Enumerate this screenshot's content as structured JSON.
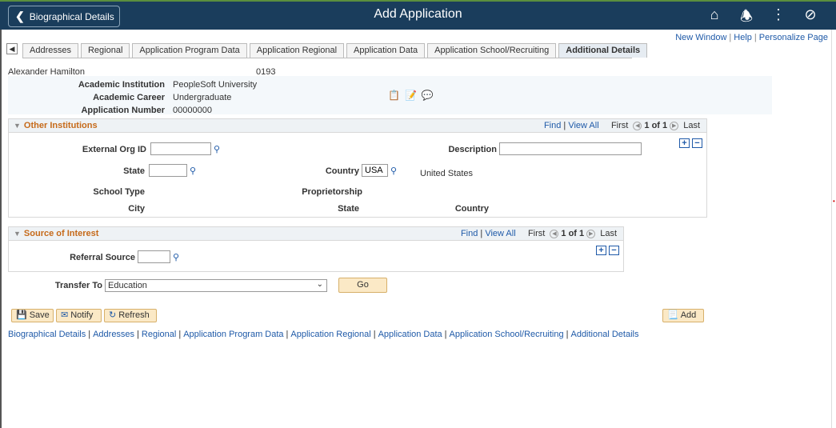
{
  "topbar": {
    "back_label": "Biographical Details",
    "title": "Add Application",
    "icons": [
      "home-icon",
      "bell-icon",
      "more-icon",
      "navbar-icon"
    ]
  },
  "toplinks": {
    "new_window": "New Window",
    "help": "Help",
    "personalize": "Personalize Page"
  },
  "tabs": [
    {
      "label": "Addresses"
    },
    {
      "label": "Regional"
    },
    {
      "label": "Application Program Data"
    },
    {
      "label": "Application Regional"
    },
    {
      "label": "Application Data"
    },
    {
      "label": "Application School/Recruiting"
    },
    {
      "label": "Additional Details",
      "active": true
    }
  ],
  "header": {
    "name": "Alexander Hamilton",
    "id": "0193",
    "institution_label": "Academic Institution",
    "institution_value": "PeopleSoft University",
    "career_label": "Academic Career",
    "career_value": "Undergraduate",
    "appnum_label": "Application Number",
    "appnum_value": "00000000"
  },
  "other_institutions": {
    "title": "Other Institutions",
    "find": "Find",
    "view_all": "View All",
    "first": "First",
    "count": "1 of 1",
    "last": "Last",
    "ext_org_label": "External Org ID",
    "ext_org_value": "",
    "description_label": "Description",
    "description_value": "",
    "state_label": "State",
    "state_value": "",
    "country_label": "Country",
    "country_value": "USA",
    "country_name": "United States",
    "school_type_label": "School Type",
    "proprietorship_label": "Proprietorship",
    "city_label": "City",
    "state2_label": "State",
    "country2_label": "Country"
  },
  "source_of_interest": {
    "title": "Source of Interest",
    "find": "Find",
    "view_all": "View All",
    "first": "First",
    "count": "1 of 1",
    "last": "Last",
    "referral_label": "Referral Source",
    "referral_value": ""
  },
  "transfer": {
    "label": "Transfer To",
    "value": "Education",
    "go": "Go"
  },
  "buttons": {
    "save": "Save",
    "notify": "Notify",
    "refresh": "Refresh",
    "add": "Add"
  },
  "bottom_links": [
    "Biographical Details",
    "Addresses",
    "Regional",
    "Application Program Data",
    "Application Regional",
    "Application Data",
    "Application School/Recruiting",
    "Additional Details"
  ]
}
